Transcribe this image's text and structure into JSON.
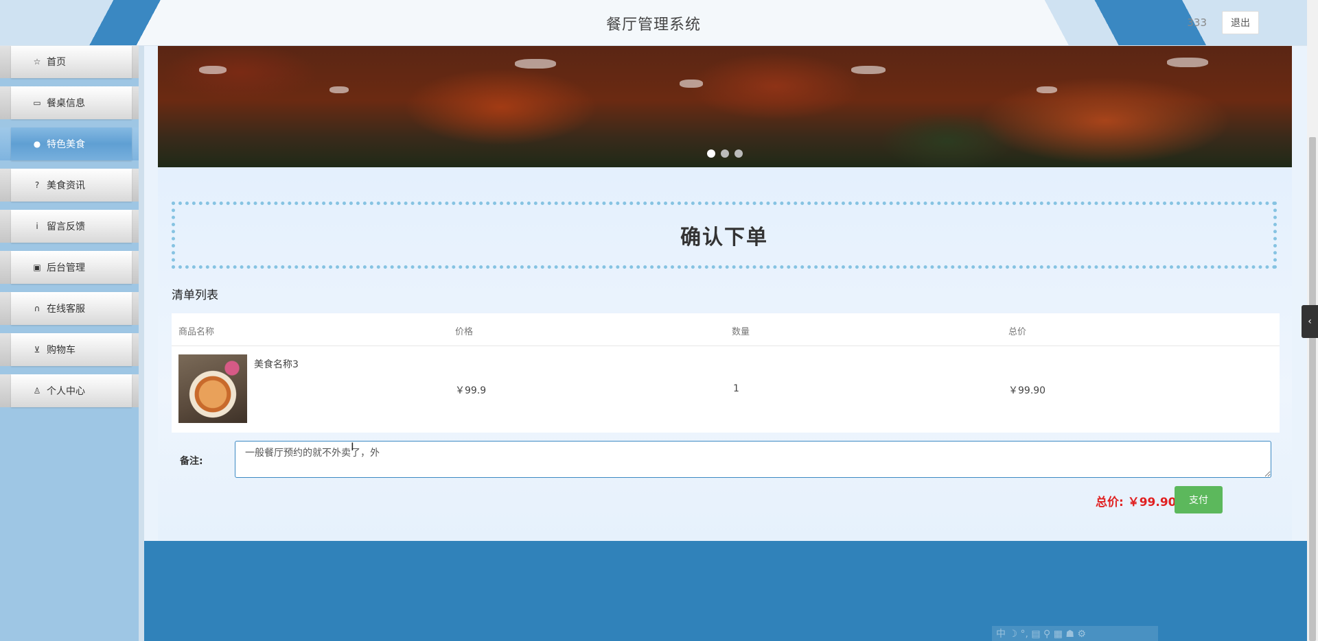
{
  "header": {
    "title": "餐厅管理系统",
    "username": "333",
    "logout_label": "退出"
  },
  "sidebar": {
    "items": [
      {
        "label": "首页",
        "icon": "star-icon",
        "glyph": "☆",
        "active": false
      },
      {
        "label": "餐桌信息",
        "icon": "bag-icon",
        "glyph": "▭",
        "active": false
      },
      {
        "label": "特色美食",
        "icon": "info-circle-icon",
        "glyph": "●",
        "active": true
      },
      {
        "label": "美食资讯",
        "icon": "question-circle-icon",
        "glyph": "?",
        "active": false
      },
      {
        "label": "留言反馈",
        "icon": "info-circle-icon",
        "glyph": "i",
        "active": false
      },
      {
        "label": "后台管理",
        "icon": "briefcase-icon",
        "glyph": "▣",
        "active": false
      },
      {
        "label": "在线客服",
        "icon": "headset-icon",
        "glyph": "∩",
        "active": false
      },
      {
        "label": "购物车",
        "icon": "cart-icon",
        "glyph": "⊻",
        "active": false
      },
      {
        "label": "个人中心",
        "icon": "user-icon",
        "glyph": "♙",
        "active": false
      }
    ]
  },
  "banner": {
    "slide_count": 3,
    "active_slide": 1
  },
  "order": {
    "confirm_title": "确认下单",
    "list_title": "清单列表",
    "columns": [
      "商品名称",
      "价格",
      "数量",
      "总价"
    ],
    "rows": [
      {
        "name": "美食名称3",
        "price": "￥99.9",
        "quantity": "1",
        "subtotal": "￥99.90"
      }
    ],
    "remark_label": "备注:",
    "remark_value": "一般餐厅预约的就不外卖了，外",
    "total_label": "总价: ￥99.90",
    "pay_label": "支付"
  },
  "ime_bar": {
    "text": "中 ☽ °, ▤ ⚲ ▦ ☗ ⚙"
  },
  "colors": {
    "accent": "#3082ba",
    "active_nav": "#6aa6d8",
    "pay_button": "#5cb85c",
    "total_price": "#e02020"
  }
}
